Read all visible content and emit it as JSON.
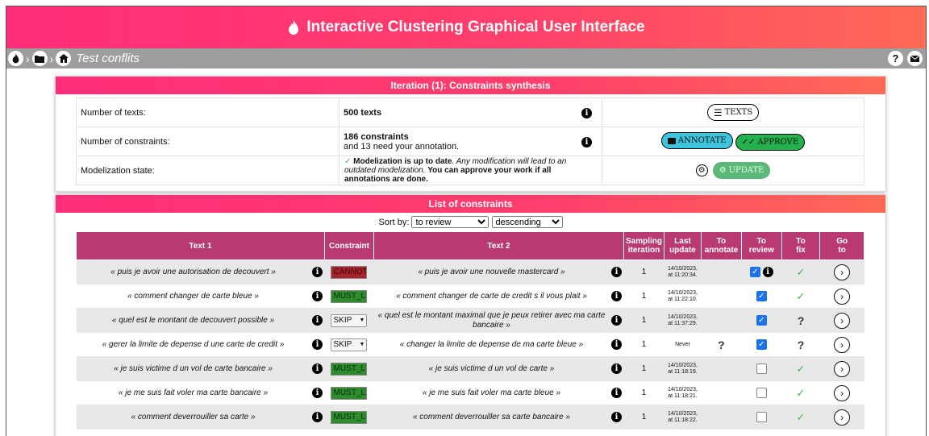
{
  "app": {
    "title": "Interactive Clustering Graphical User Interface"
  },
  "breadcrumb": {
    "project_label": "Test conflits"
  },
  "synthesis": {
    "title": "Iteration (1): Constraints synthesis",
    "rows": [
      {
        "label": "Number of texts:",
        "value_main": "500 texts",
        "value_sub": ""
      },
      {
        "label": "Number of constraints:",
        "value_main": "186 constraints",
        "value_sub": "and 13 need your annotation."
      },
      {
        "label": "Modelization state:"
      }
    ],
    "modelization": {
      "status_bold": "Modelization is up to date",
      "note_italic": ". Any modification will lead to an outdated modelization.",
      "note_bold": " You can approve your work if all annotations are done."
    },
    "buttons": {
      "texts": "TEXTS",
      "annotate": "ANNOTATE",
      "approve": "APPROVE",
      "update": "UPDATE"
    }
  },
  "constraints": {
    "title": "List of constraints",
    "sort_label": "Sort by:",
    "sort_by_value": "to review",
    "sort_order_value": "descending",
    "headers": {
      "text1": "Text 1",
      "constraint": "Constraint",
      "text2": "Text 2",
      "sampling_1": "Sampling",
      "sampling_2": "iteration",
      "last_1": "Last",
      "last_2": "update",
      "annotate_1": "To",
      "annotate_2": "annotate",
      "review_1": "To",
      "review_2": "review",
      "fix_1": "To",
      "fix_2": "fix",
      "goto_1": "Go",
      "goto_2": "to"
    },
    "rows": [
      {
        "text1": "« puis je avoir une autorisation de decouvert »",
        "constraint": "CANNOT",
        "text2": "« puis je avoir une nouvelle mastercard »",
        "iteration": "1",
        "date1": "14/10/2023,",
        "date2": "at 11:20:34.",
        "to_annotate": "",
        "to_review": true,
        "to_fix": "✓"
      },
      {
        "text1": "« comment changer de carte bleue »",
        "constraint": "MUST_LINK",
        "text2": "« comment changer de carte de credit s il vous plait »",
        "iteration": "1",
        "date1": "14/10/2023,",
        "date2": "at 11:22:10.",
        "to_annotate": "",
        "to_review": true,
        "to_fix": "✓"
      },
      {
        "text1": "« quel est le montant de decouvert possible »",
        "constraint": "SKIP",
        "text2": "« quel est le montant maximal que je peux retirer avec ma carte bancaire »",
        "iteration": "1",
        "date1": "14/10/2023,",
        "date2": "at 11:37:29.",
        "to_annotate": "",
        "to_review": true,
        "to_fix": "?"
      },
      {
        "text1": "« gerer la limite de depense d une carte de credit »",
        "constraint": "SKIP",
        "text2": "« changer la limite de depense de ma carte bleue »",
        "iteration": "1",
        "date1": "Never",
        "date2": "",
        "to_annotate": "?",
        "to_review": true,
        "to_fix": "?"
      },
      {
        "text1": "« je suis victime d un vol de carte bancaire »",
        "constraint": "MUST_LINK",
        "text2": "« je suis victime d un vol de carte »",
        "iteration": "1",
        "date1": "14/10/2023,",
        "date2": "at 11:18:19.",
        "to_annotate": "",
        "to_review": false,
        "to_fix": "✓"
      },
      {
        "text1": "« je me suis fait voler ma carte bancaire »",
        "constraint": "MUST_LINK",
        "text2": "« je me suis fait voler ma carte bleue »",
        "iteration": "1",
        "date1": "14/10/2023,",
        "date2": "at 11:18:21.",
        "to_annotate": "",
        "to_review": false,
        "to_fix": "✓"
      },
      {
        "text1": "« comment deverrouiller sa carte »",
        "constraint": "MUST_LINK",
        "text2": "« comment deverrouiller sa carte bancaire »",
        "iteration": "1",
        "date1": "14/10/2023,",
        "date2": "at 11:18:22.",
        "to_annotate": "",
        "to_review": false,
        "to_fix": "✓"
      }
    ]
  },
  "icons": {
    "flame": "flame-icon",
    "home": "home-icon",
    "folder": "folder-icon",
    "help": "help-icon",
    "mail": "mail-icon",
    "info": "info-icon",
    "goto": "chevron-right-icon"
  },
  "colors": {
    "header_pink": "#ff3f6b",
    "table_header": "#b83a70",
    "cannot": "#a8242d",
    "must_link": "#2e8b2e",
    "annotate_btn": "#3ec4dd",
    "approve_btn": "#22b14c"
  }
}
